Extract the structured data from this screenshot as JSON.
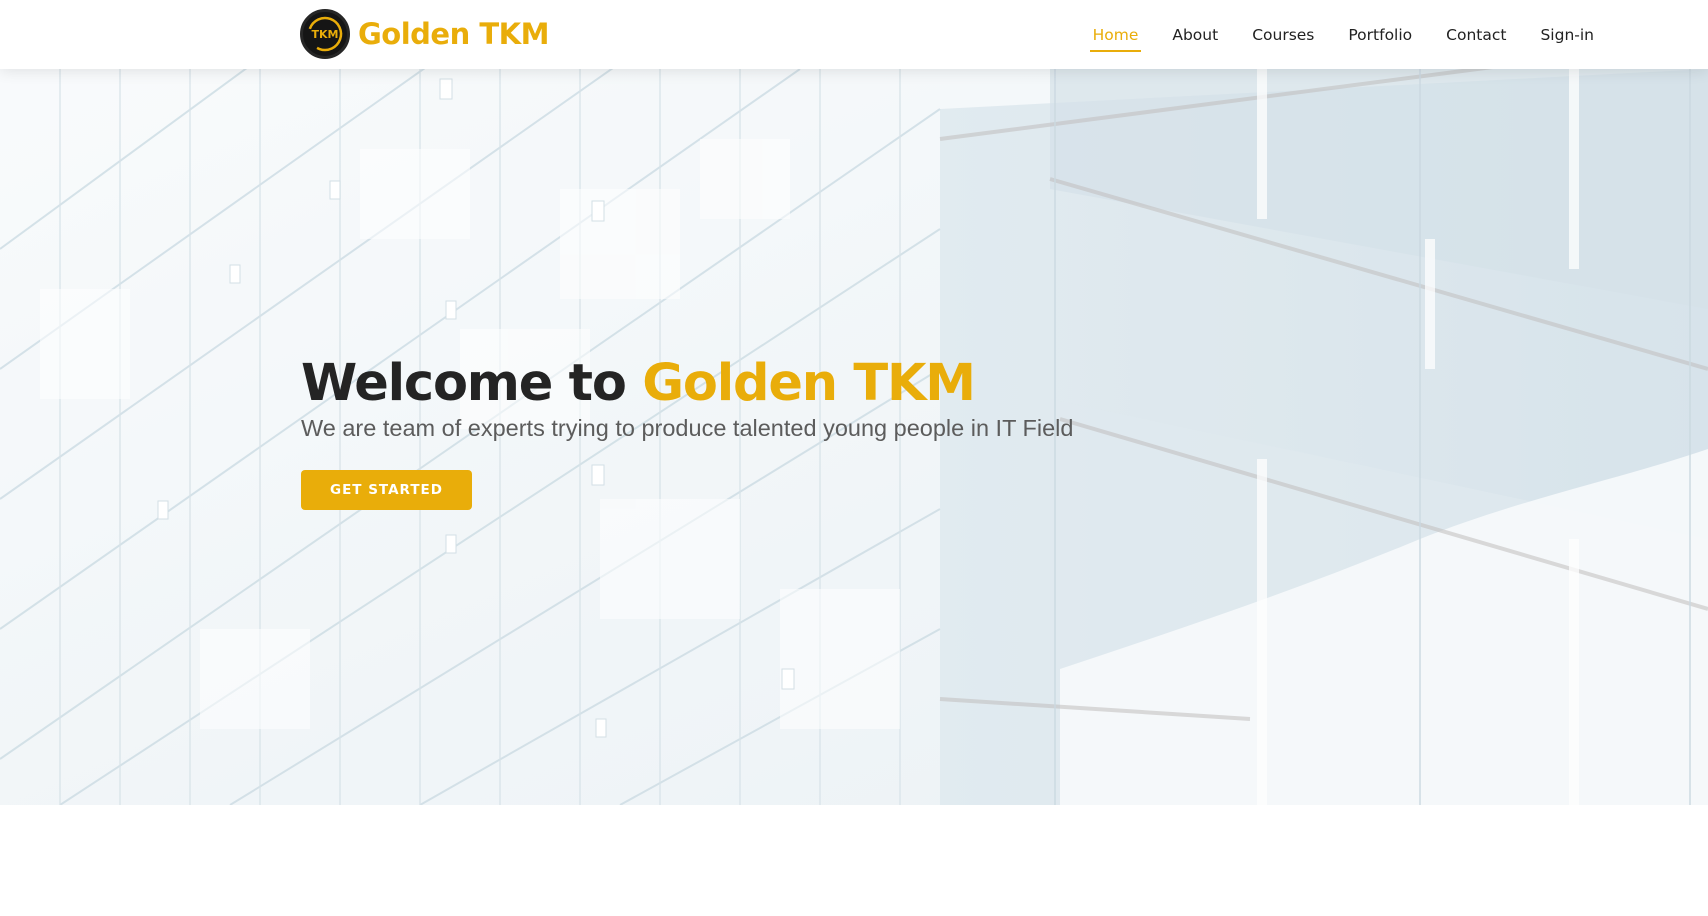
{
  "brand": {
    "name": "Golden TKM",
    "logo_text": "TKM",
    "accent_color": "#e9ad0a"
  },
  "nav": {
    "items": [
      {
        "label": "Home",
        "active": true
      },
      {
        "label": "About",
        "active": false
      },
      {
        "label": "Courses",
        "active": false
      },
      {
        "label": "Portfolio",
        "active": false
      },
      {
        "label": "Contact",
        "active": false
      },
      {
        "label": "Sign-in",
        "active": false
      }
    ]
  },
  "hero": {
    "title_prefix": "Welcome to ",
    "title_accent": "Golden TKM",
    "subtitle": "We are team of experts trying to produce talented young people in IT Field",
    "cta_label": "GET STARTED",
    "background": "glass-building-photo"
  }
}
